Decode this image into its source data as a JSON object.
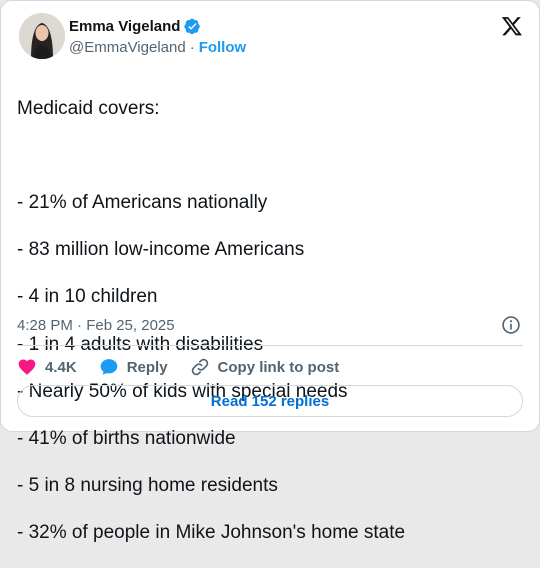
{
  "author": {
    "name": "Emma Vigeland",
    "handle": "@EmmaVigeland",
    "separator": "·",
    "follow_label": "Follow"
  },
  "tweet": {
    "lines": [
      "Medicaid covers:",
      "",
      "- 21% of Americans nationally",
      "- 83 million low-income Americans",
      "- 4 in 10 children",
      "- 1 in 4 adults with disabilities",
      "- Nearly 50% of kids with special needs",
      "- 41% of births nationwide",
      "- 5 in 8 nursing home residents",
      "- 32% of people in Mike Johnson's home state"
    ],
    "timestamp": "4:28 PM · Feb 25, 2025"
  },
  "actions": {
    "like_count": "4.4K",
    "reply_label": "Reply",
    "copy_label": "Copy link to post"
  },
  "read_replies_label": "Read 152 replies",
  "colors": {
    "accent": "#1d9bf0",
    "like": "#f91880",
    "text": "#0f1419",
    "muted": "#536471",
    "border": "#cfd9de"
  },
  "icons": [
    "verified-badge-icon",
    "x-logo-icon",
    "info-icon",
    "heart-icon",
    "reply-bubble-icon",
    "link-icon"
  ]
}
